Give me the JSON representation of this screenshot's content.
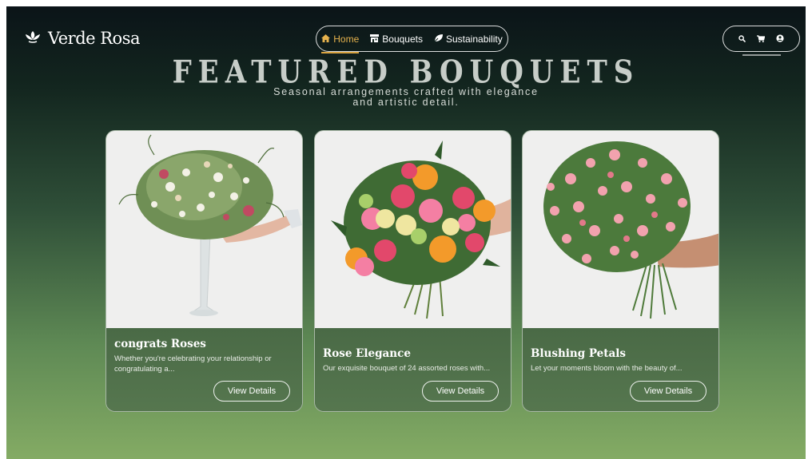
{
  "brand": {
    "name": "Verde Rosa",
    "icon": "lotus-icon"
  },
  "nav": {
    "items": [
      {
        "label": "Home",
        "icon": "home-icon",
        "active": true
      },
      {
        "label": "Bouquets",
        "icon": "store-icon",
        "active": false
      },
      {
        "label": "Sustainability",
        "icon": "leaf-icon",
        "active": false
      }
    ]
  },
  "header_icons": [
    "search-icon",
    "cart-icon",
    "user-icon"
  ],
  "hero": {
    "title": "FEATURED BOUQUETS",
    "subtitle": "Seasonal arrangements crafted with elegance and artistic detail."
  },
  "cards": [
    {
      "title": "congrats Roses",
      "description": "Whether you're celebrating your relationship or congratulating a...",
      "button": "View Details"
    },
    {
      "title": "Rose Elegance",
      "description": "Our exquisite bouquet of 24 assorted roses with...",
      "button": "View Details"
    },
    {
      "title": "Blushing Petals",
      "description": "Let your moments bloom with the beauty of...",
      "button": "View Details"
    }
  ],
  "colors": {
    "accent": "#e6b24d",
    "card_body": "#4f6e4a",
    "background_top": "#0b1418",
    "background_bottom": "#84ab64"
  }
}
